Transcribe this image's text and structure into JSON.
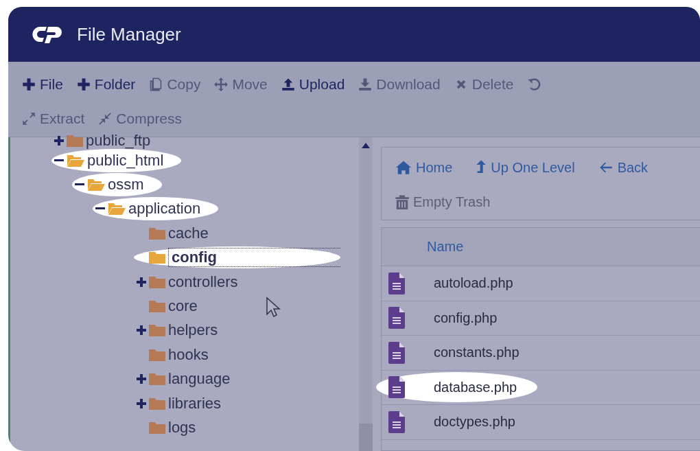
{
  "window": {
    "title": "File Manager"
  },
  "toolbar": [
    {
      "label": "File",
      "disabled": false
    },
    {
      "label": "Folder",
      "disabled": false
    },
    {
      "label": "Copy",
      "disabled": true
    },
    {
      "label": "Move",
      "disabled": true
    },
    {
      "label": "Upload",
      "disabled": false
    },
    {
      "label": "Download",
      "disabled": true
    },
    {
      "label": "Delete",
      "disabled": true
    },
    {
      "disabled": true
    },
    {
      "label": "Extract",
      "disabled": true
    },
    {
      "label": "Compress",
      "disabled": true
    }
  ],
  "tree": [
    {
      "name": "public_ftp",
      "expanded": false,
      "selected": false,
      "highlighted": false
    },
    {
      "name": "public_html",
      "expanded": true,
      "selected": false,
      "highlighted": true,
      "children": [
        {
          "name": "ossm",
          "expanded": true,
          "selected": false,
          "highlighted": true,
          "children": [
            {
              "name": "application",
              "expanded": true,
              "selected": false,
              "highlighted": true,
              "children": [
                {
                  "name": "cache",
                  "selected": false,
                  "highlighted": false
                },
                {
                  "name": "config",
                  "selected": true,
                  "highlighted": true
                },
                {
                  "name": "controllers",
                  "expanded": false,
                  "selected": false,
                  "highlighted": false
                },
                {
                  "name": "core",
                  "selected": false,
                  "highlighted": false
                },
                {
                  "name": "helpers",
                  "expanded": false,
                  "selected": false,
                  "highlighted": false
                },
                {
                  "name": "hooks",
                  "selected": false,
                  "highlighted": false
                },
                {
                  "name": "language",
                  "expanded": false,
                  "selected": false,
                  "highlighted": false
                },
                {
                  "name": "libraries",
                  "expanded": false,
                  "selected": false,
                  "highlighted": false
                },
                {
                  "name": "logs",
                  "selected": false,
                  "highlighted": false
                }
              ]
            }
          ]
        }
      ]
    }
  ],
  "navigation": [
    {
      "label": "Home",
      "disabled": false
    },
    {
      "label": "Up One Level",
      "disabled": false
    },
    {
      "label": "Back",
      "disabled": false
    },
    {
      "label": "Empty Trash",
      "disabled": true
    }
  ],
  "table": {
    "columns": [
      "Name"
    ],
    "rows": [
      {
        "name": "autoload.php",
        "highlighted": false
      },
      {
        "name": "config.php",
        "highlighted": false
      },
      {
        "name": "constants.php",
        "highlighted": false
      },
      {
        "name": "database.php",
        "highlighted": true
      },
      {
        "name": "doctypes.php",
        "highlighted": false
      }
    ]
  }
}
